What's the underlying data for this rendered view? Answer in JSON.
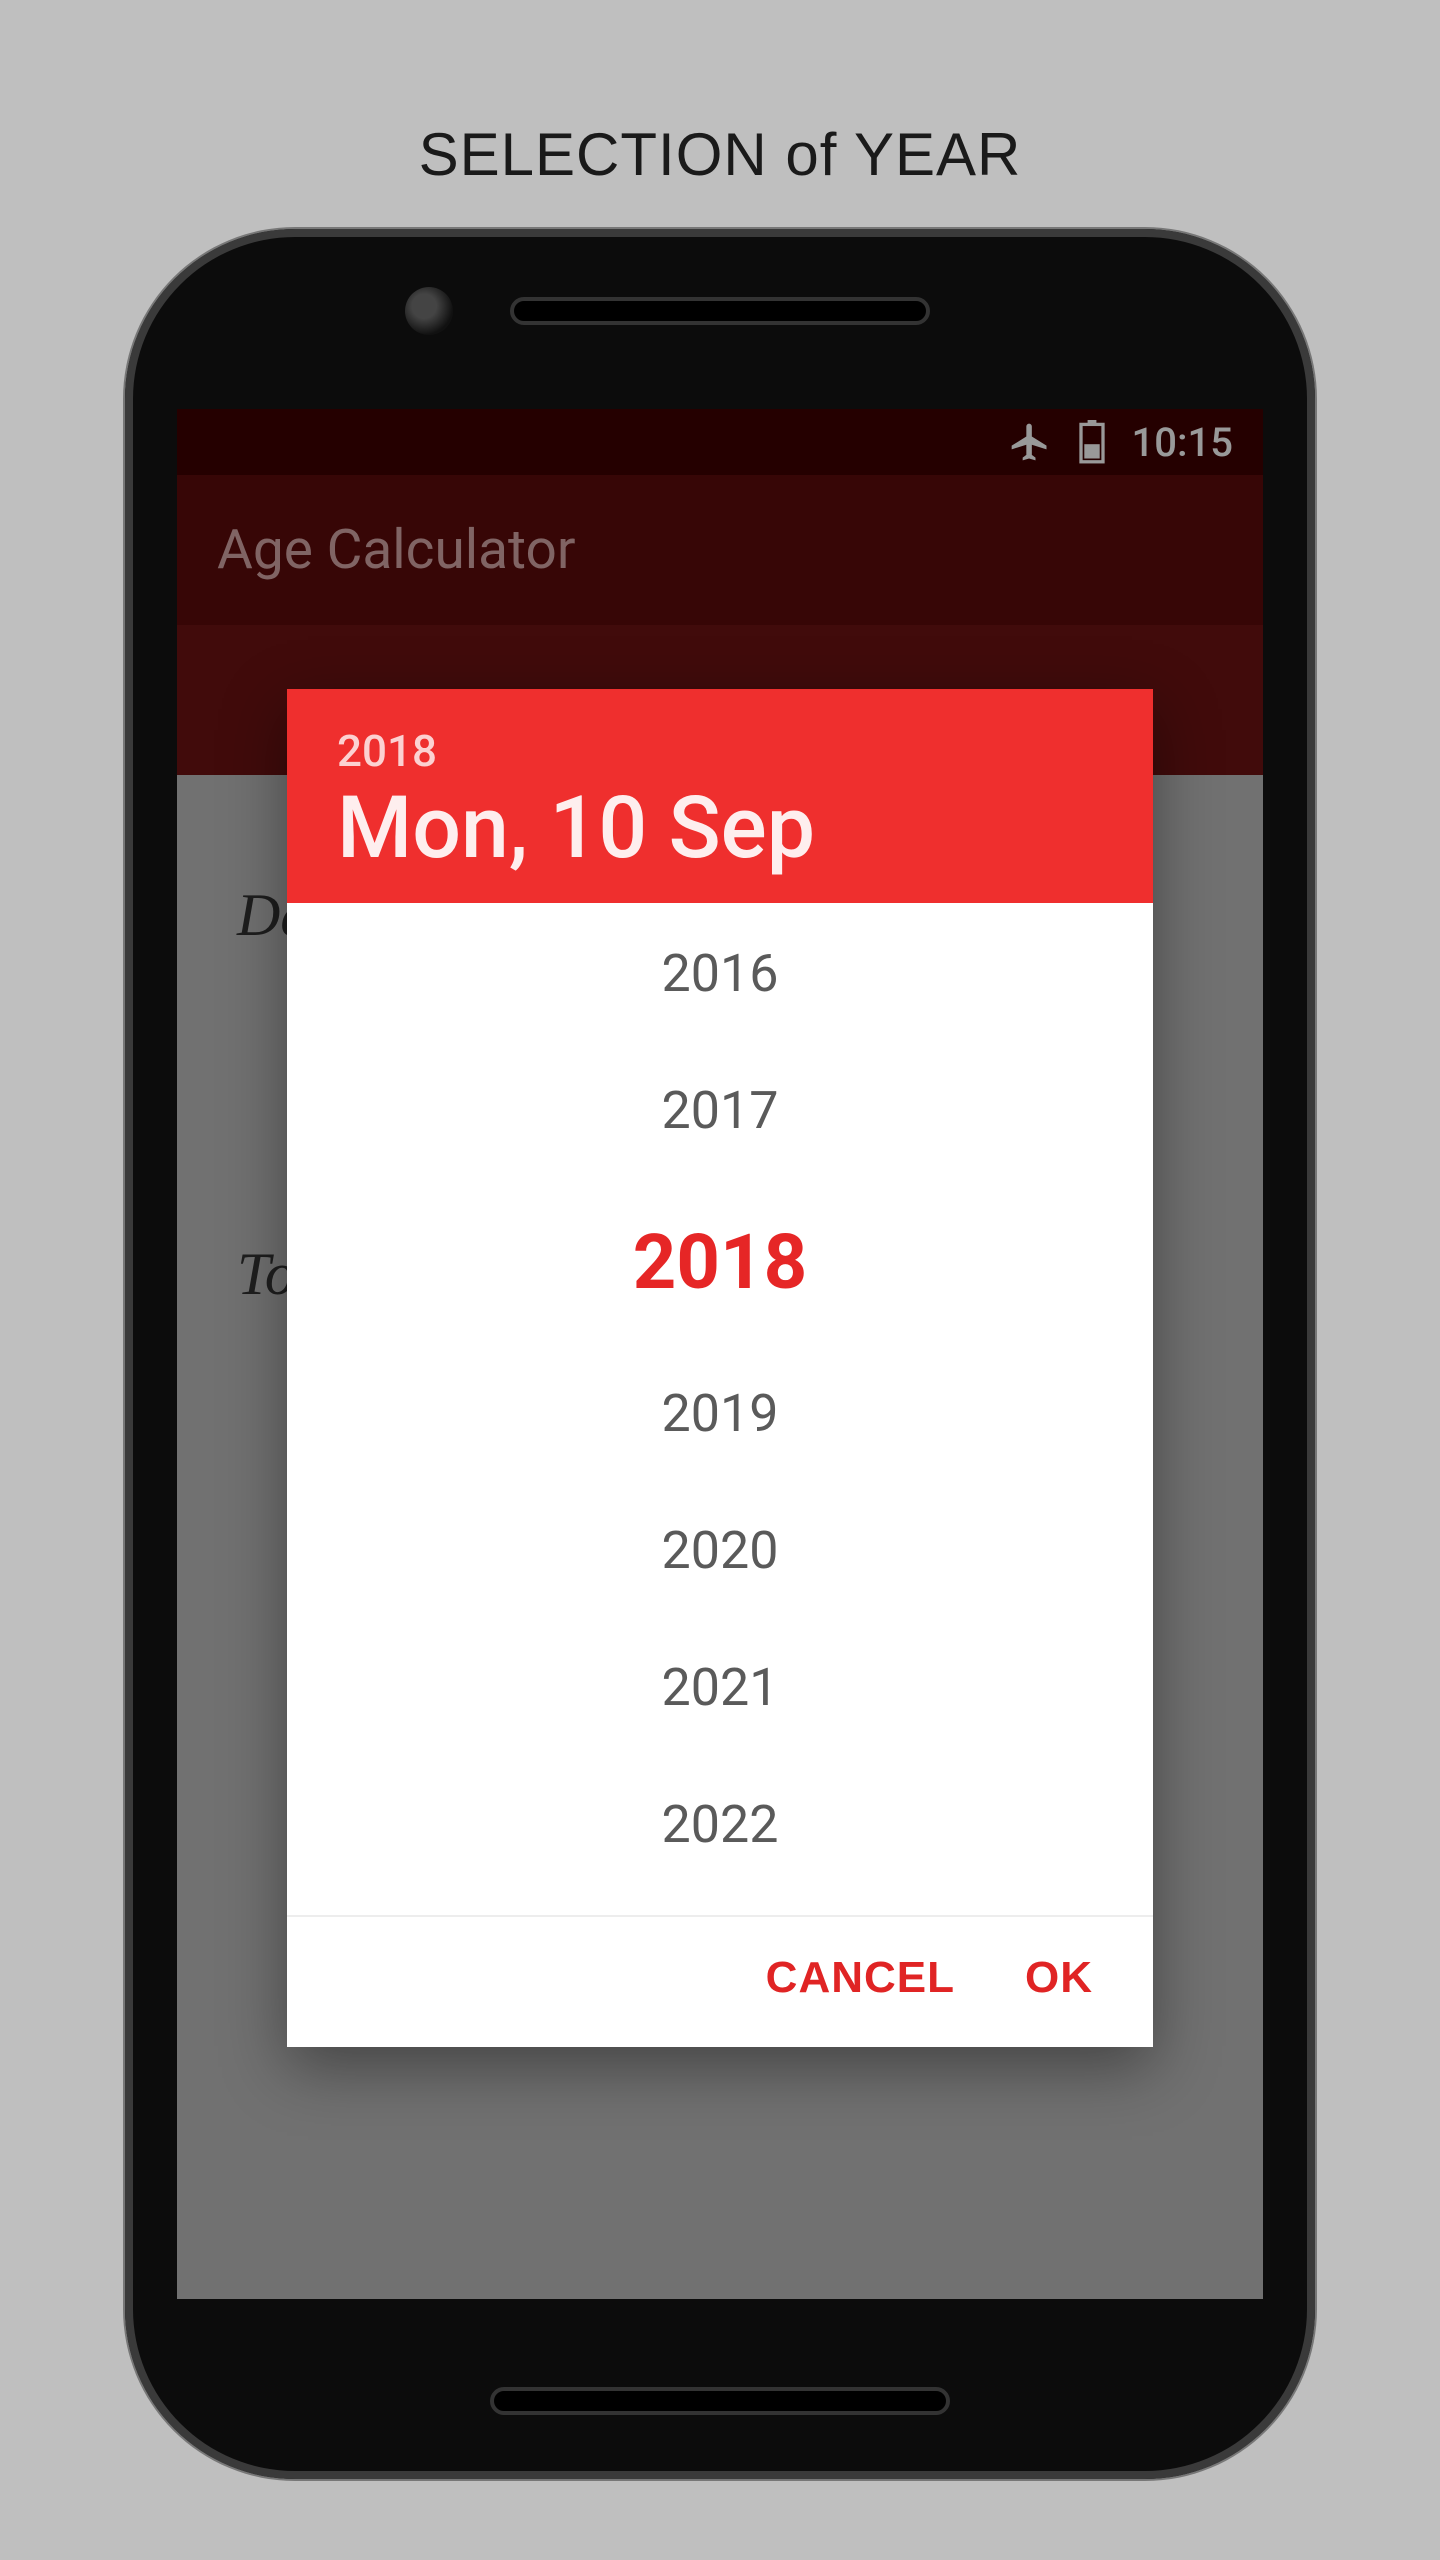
{
  "caption": "SELECTION of YEAR",
  "status": {
    "time": "10:15"
  },
  "appbar": {
    "title": "Age Calculator"
  },
  "background": {
    "label1": "Da",
    "label2": "To"
  },
  "dialog": {
    "year": "2018",
    "date": "Mon, 10 Sep",
    "years": [
      "2016",
      "2017",
      "2018",
      "2019",
      "2020",
      "2021",
      "2022"
    ],
    "selected_year": "2018",
    "actions": {
      "cancel": "CANCEL",
      "ok": "OK"
    }
  }
}
